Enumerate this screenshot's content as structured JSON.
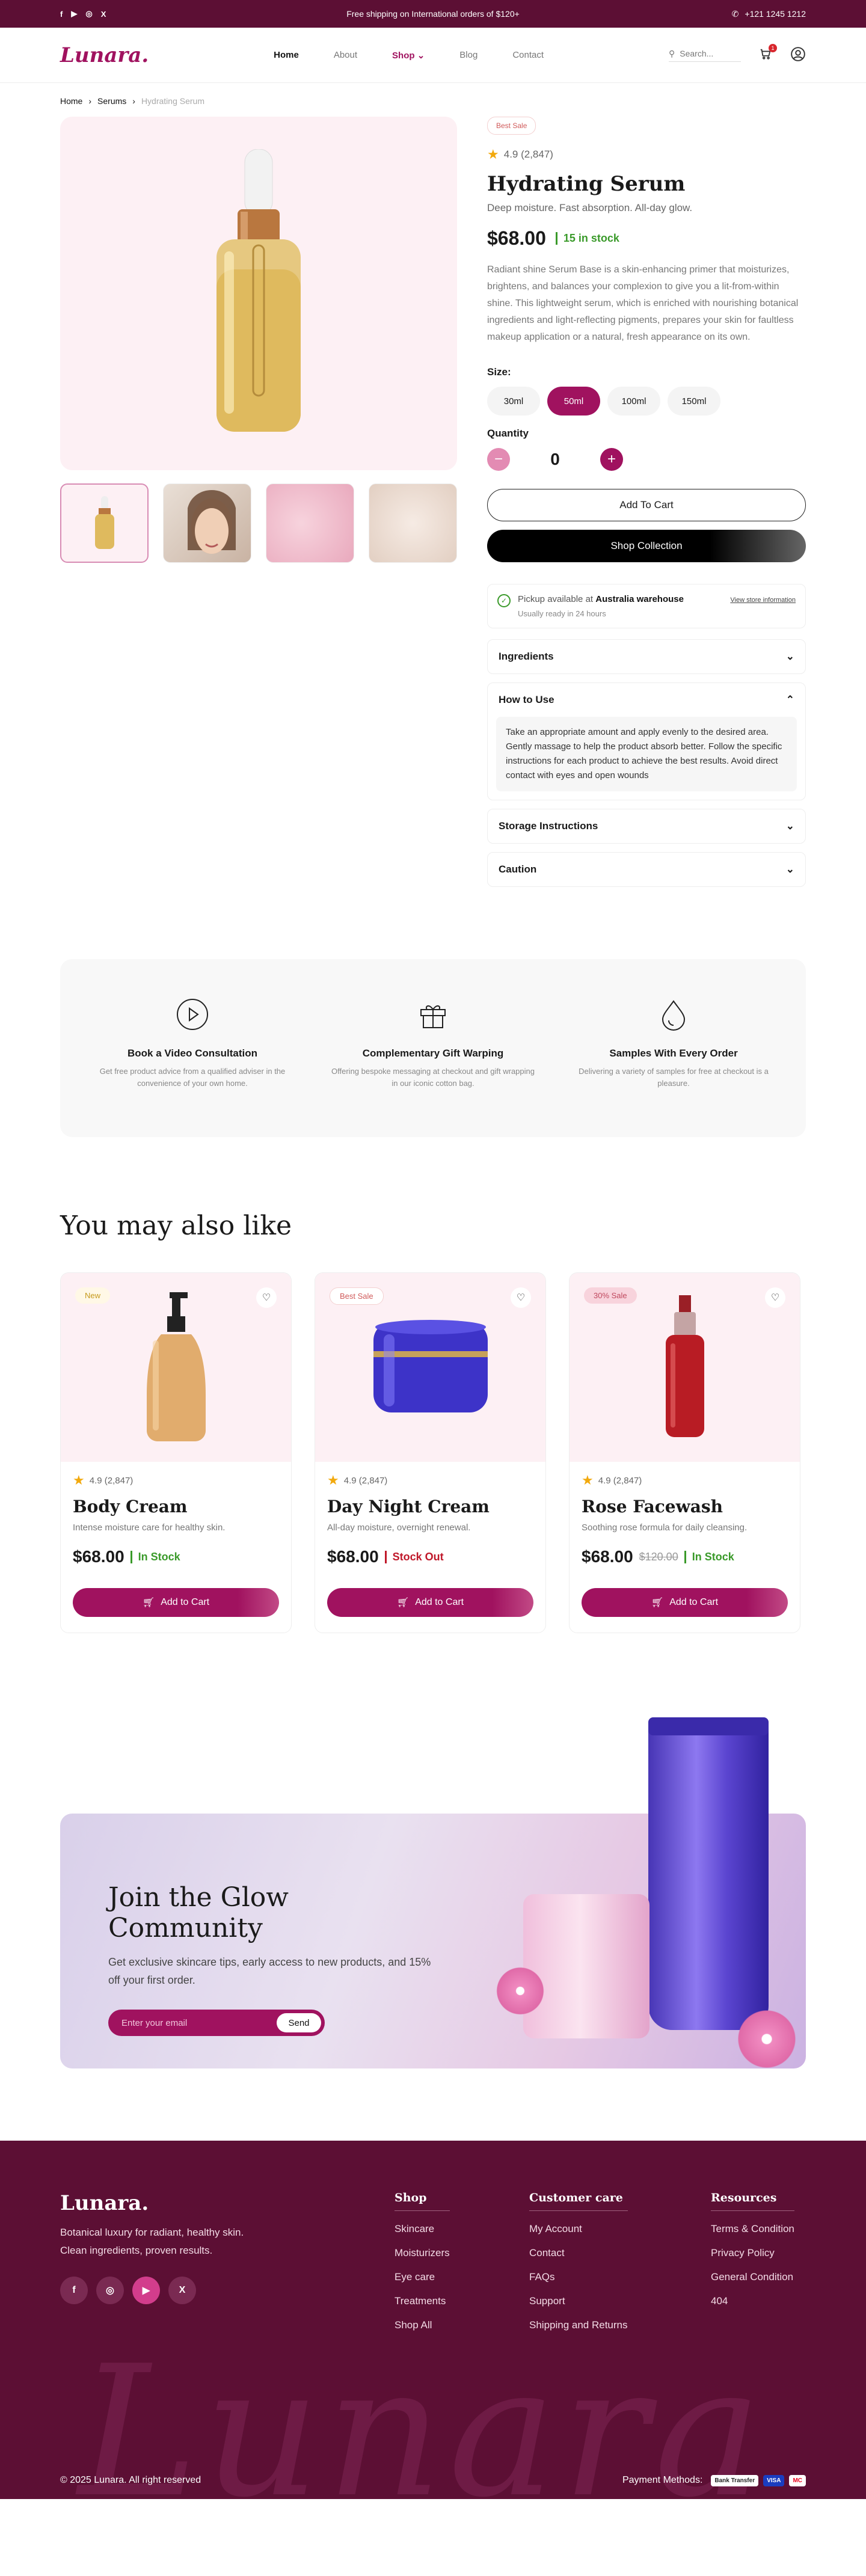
{
  "topbar": {
    "shipping": "Free shipping on International orders of $120+",
    "phone": "+121 1245 1212",
    "social": [
      "f",
      "▶",
      "◎",
      "X"
    ]
  },
  "header": {
    "logo": "Lunara.",
    "nav": [
      "Home",
      "About",
      "Shop",
      "Blog",
      "Contact"
    ],
    "search_placeholder": "Search...",
    "cart_count": "1"
  },
  "breadcrumb": [
    "Home",
    "Serums",
    "Hydrating Serum"
  ],
  "product": {
    "badge": "Best Sale",
    "rating": "4.9 (2,847)",
    "title": "Hydrating Serum",
    "subtitle": "Deep moisture. Fast absorption. All-day glow.",
    "price": "$68.00",
    "stock": "15 in stock",
    "description": "Radiant shine Serum Base is a skin-enhancing primer that moisturizes, brightens, and balances your complexion to give you a lit-from-within shine. This lightweight serum, which is enriched with nourishing botanical ingredients and light-reflecting pigments, prepares your skin for faultless makeup application or a natural, fresh appearance on its own.",
    "size_label": "Size:",
    "sizes": [
      "30ml",
      "50ml",
      "100ml",
      "150ml"
    ],
    "selected_size": "50ml",
    "quantity_label": "Quantity",
    "quantity": "0",
    "add_to_cart": "Add To Cart",
    "shop_collection": "Shop Collection",
    "pickup_prefix": "Pickup available at",
    "pickup_location": "Australia warehouse",
    "pickup_note": "Usually ready in 24 hours",
    "store_info": "View store information",
    "accordion": [
      {
        "title": "Ingredients",
        "open": false
      },
      {
        "title": "How to Use",
        "open": true,
        "body": "Take an appropriate amount and apply evenly to the desired area. Gently massage to help the product absorb better. Follow the specific instructions for each product to achieve the best results. Avoid direct contact with eyes and open wounds"
      },
      {
        "title": "Storage Instructions",
        "open": false
      },
      {
        "title": "Caution",
        "open": false
      }
    ]
  },
  "features": [
    {
      "title": "Book a Video Consultation",
      "desc": "Get free product advice from a qualified adviser in the convenience of your own home.",
      "icon": "play-circle-icon"
    },
    {
      "title": "Complementary Gift Warping",
      "desc": "Offering bespoke messaging at checkout and gift wrapping in our iconic cotton bag.",
      "icon": "gift-icon"
    },
    {
      "title": "Samples With Every Order",
      "desc": "Delivering a variety of samples for free at checkout is a pleasure.",
      "icon": "drop-icon"
    }
  ],
  "related": {
    "title": "You may also like",
    "cards": [
      {
        "badge": "New",
        "badge_bg": "#fff8e6",
        "badge_color": "#c69a1c",
        "rating": "4.9 (2,847)",
        "name": "Body Cream",
        "desc": "Intense moisture care for healthy skin.",
        "price": "$68.00",
        "old_price": "",
        "stock": "In Stock",
        "stock_color": "#3a9a2a",
        "button": "Add to Cart"
      },
      {
        "badge": "Best Sale",
        "badge_bg": "#fff",
        "badge_color": "#d05a5a",
        "rating": "4.9 (2,847)",
        "name": "Day Night Cream",
        "desc": "All-day moisture, overnight renewal.",
        "price": "$68.00",
        "old_price": "",
        "stock": "Stock Out",
        "stock_color": "#c0182a",
        "button": "Add to Cart"
      },
      {
        "badge": "30% Sale",
        "badge_bg": "#f8d3dc",
        "badge_color": "#c0485e",
        "rating": "4.9 (2,847)",
        "name": "Rose Facewash",
        "desc": "Soothing rose formula for daily cleansing.",
        "price": "$68.00",
        "old_price": "$120.00",
        "stock": "In Stock",
        "stock_color": "#3a9a2a",
        "button": "Add to Cart"
      }
    ]
  },
  "newsletter": {
    "title": "Join the Glow Community",
    "text": "Get exclusive skincare tips, early access to new products, and 15% off your first order.",
    "placeholder": "Enter your email",
    "button": "Send"
  },
  "footer": {
    "logo": "Lunara.",
    "tagline_1": "Botanical luxury for radiant, healthy skin.",
    "tagline_2": "Clean ingredients, proven results.",
    "watermark": "Lunara",
    "columns": [
      {
        "title": "Shop",
        "links": [
          "Skincare",
          "Moisturizers",
          "Eye care",
          "Treatments",
          "Shop All"
        ]
      },
      {
        "title": "Customer care",
        "links": [
          "My Account",
          "Contact",
          "FAQs",
          "Support",
          "Shipping and Returns"
        ]
      },
      {
        "title": "Resources",
        "links": [
          "Terms & Condition",
          "Privacy Policy",
          "General Condition",
          "404"
        ]
      }
    ],
    "copyright": "© 2025 Lunara. All right reserved",
    "payment_label": "Payment Methods:",
    "payments": [
      "Bank Transfer",
      "VISA",
      "MC"
    ]
  },
  "colors": {
    "brand": "#a0125f",
    "dark": "#5c0f34",
    "green": "#3a9a2a"
  }
}
